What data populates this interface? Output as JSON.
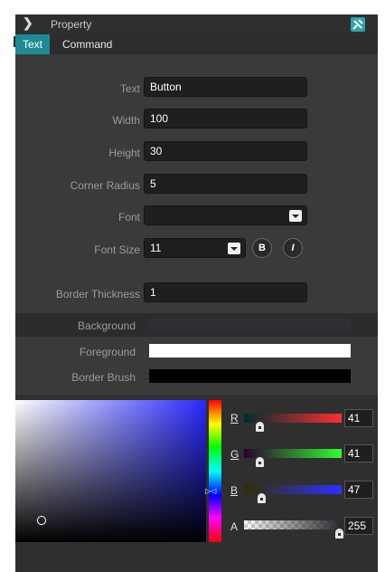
{
  "titlebar": {
    "title": "Property",
    "expand_icon": "chevron-right-icon",
    "pin_icon": "pin-icon"
  },
  "tabs": [
    {
      "label": "Text",
      "active": true
    },
    {
      "label": "Command",
      "active": false
    }
  ],
  "fields": {
    "text": {
      "label": "Text",
      "value": "Button"
    },
    "width": {
      "label": "Width",
      "value": "100"
    },
    "height": {
      "label": "Height",
      "value": "30"
    },
    "corner_radius": {
      "label": "Corner Radius",
      "value": "5"
    },
    "font": {
      "label": "Font",
      "value": ""
    },
    "font_size": {
      "label": "Font Size",
      "value": "11"
    },
    "border_thickness": {
      "label": "Border Thickness",
      "value": "1"
    }
  },
  "font_style": {
    "bold_label": "B",
    "italic_label": "I"
  },
  "brushes": {
    "background": {
      "label": "Background",
      "color": "#2f2f33"
    },
    "foreground": {
      "label": "Foreground",
      "color": "#ffffff"
    },
    "border_brush": {
      "label": "Border Brush",
      "color": "#000000"
    }
  },
  "color_picker": {
    "base_hue_color": "#2929ff",
    "channels": [
      {
        "label": "R",
        "value": "41",
        "fraction": 0.16
      },
      {
        "label": "G",
        "value": "41",
        "fraction": 0.16
      },
      {
        "label": "B",
        "value": "47",
        "fraction": 0.18
      },
      {
        "label": "A",
        "value": "255",
        "fraction": 1.0
      }
    ]
  },
  "colors": {
    "accent": "#1d8a96",
    "panel": "#3a3a3a"
  }
}
